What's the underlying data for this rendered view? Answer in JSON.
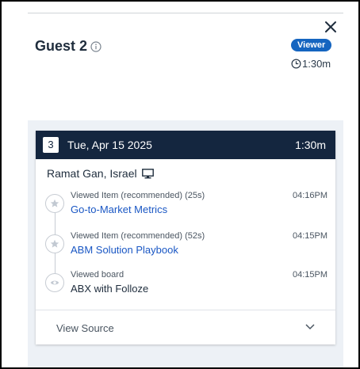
{
  "guest": {
    "name": "Guest 2",
    "role_badge": "Viewer",
    "total_time": "1:30m"
  },
  "session": {
    "number": "3",
    "date": "Tue, Apr 15 2025",
    "duration": "1:30m",
    "location": "Ramat Gan, Israel",
    "activities": [
      {
        "type": "Viewed Item (recommended) (25s)",
        "title": "Go-to-Market Metrics",
        "time": "04:16PM",
        "icon": "star-icon"
      },
      {
        "type": "Viewed Item (recommended) (52s)",
        "title": "ABM Solution Playbook",
        "time": "04:15PM",
        "icon": "star-icon"
      },
      {
        "type": "Viewed board",
        "title": "ABX with Folloze",
        "time": "04:15PM",
        "icon": "eye-icon"
      }
    ],
    "view_source_label": "View Source"
  },
  "colors": {
    "header_bg": "#14263f",
    "badge_bg": "#1565c0",
    "link": "#1a57c4",
    "panel_bg": "#edf1f6"
  }
}
